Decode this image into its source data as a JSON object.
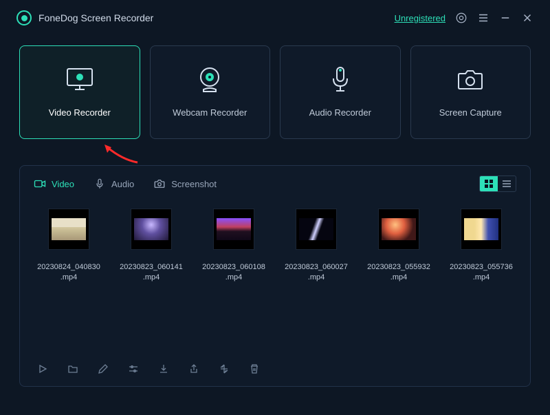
{
  "app": {
    "title": "FoneDog Screen Recorder"
  },
  "header": {
    "status": "Unregistered"
  },
  "modes": [
    {
      "label": "Video Recorder",
      "icon": "monitor",
      "active": true
    },
    {
      "label": "Webcam Recorder",
      "icon": "webcam",
      "active": false
    },
    {
      "label": "Audio Recorder",
      "icon": "mic",
      "active": false
    },
    {
      "label": "Screen Capture",
      "icon": "camera",
      "active": false
    }
  ],
  "tabs": [
    {
      "label": "Video",
      "icon": "video",
      "active": true
    },
    {
      "label": "Audio",
      "icon": "mic",
      "active": false
    },
    {
      "label": "Screenshot",
      "icon": "camera",
      "active": false
    }
  ],
  "files": [
    {
      "name": "20230824_040830.mp4",
      "thumb_style": "sunset"
    },
    {
      "name": "20230823_060141.mp4",
      "thumb_style": "concert1"
    },
    {
      "name": "20230823_060108.mp4",
      "thumb_style": "concert2"
    },
    {
      "name": "20230823_060027.mp4",
      "thumb_style": "beam"
    },
    {
      "name": "20230823_055932.mp4",
      "thumb_style": "concert3"
    },
    {
      "name": "20230823_055736.mp4",
      "thumb_style": "cosplay"
    }
  ],
  "colors": {
    "accent": "#2de0b8",
    "panel": "#0f1a29",
    "bg": "#0d1724"
  }
}
